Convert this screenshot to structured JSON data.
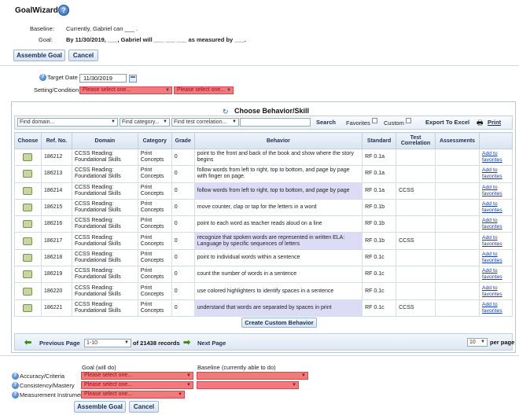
{
  "header": {
    "title": "GoalWizard",
    "help_glyph": "?",
    "baseline_label": "Baseline:",
    "baseline_text": "Currently, Gabriel can ___ .",
    "goal_label": "Goal:",
    "goal_text": "By 11/30/2019, ___, Gabriel will ___ ___ ___ as measured by ___.",
    "assemble_label": "Assemble Goal",
    "cancel_label": "Cancel"
  },
  "settings": {
    "target_date_label": "Target Date",
    "target_date_value": "11/30/2019",
    "setting_label": "Setting/Condition",
    "select_placeholder": "Please select one..."
  },
  "behavior": {
    "heading": "Choose Behavior/Skill",
    "find_domain": "Find domain...",
    "find_category": "Find category...",
    "find_test": "Find test correlation...",
    "search_label": "Search",
    "favorites_label": "Favorites",
    "custom_label": "Custom",
    "export_label": "Export To Excel",
    "print_label": "Print",
    "columns": [
      "Choose",
      "Ref. No.",
      "Domain",
      "Category",
      "Grade",
      "Behavior",
      "Standard",
      "Test Correlation",
      "Assessments",
      ""
    ],
    "rows": [
      {
        "ref": "186212",
        "domain": "CCSS Reading: Foundational Skills",
        "category": "Print Concepts",
        "grade": "0",
        "behavior": "point to the front and back of the book and show where the story begins",
        "standard": "RF 0.1a",
        "test": "",
        "fav": "Add to favorites",
        "hl": false
      },
      {
        "ref": "186213",
        "domain": "CCSS Reading: Foundational Skills",
        "category": "Print Concepts",
        "grade": "0",
        "behavior": "follow words from left to right, top to bottom, and page by page with finger on page.",
        "standard": "RF 0.1a",
        "test": "",
        "fav": "Add to favorites",
        "hl": false
      },
      {
        "ref": "186214",
        "domain": "CCSS Reading: Foundational Skills",
        "category": "Print Concepts",
        "grade": "0",
        "behavior": "follow words from left to right, top to bottom, and page by page",
        "standard": "RF 0.1a",
        "test": "CCSS",
        "fav": "Add to favorites",
        "hl": true
      },
      {
        "ref": "186215",
        "domain": "CCSS Reading: Foundational Skills",
        "category": "Print Concepts",
        "grade": "0",
        "behavior": "move counter, clap or tap for the letters in a word",
        "standard": "RF 0.1b",
        "test": "",
        "fav": "Add to favorites",
        "hl": false
      },
      {
        "ref": "186216",
        "domain": "CCSS Reading: Foundational Skills",
        "category": "Print Concepts",
        "grade": "0",
        "behavior": "point to each word as teacher reads aloud on a line",
        "standard": "RF 0.1b",
        "test": "",
        "fav": "Add to favorites",
        "hl": false
      },
      {
        "ref": "186217",
        "domain": "CCSS Reading: Foundational Skills",
        "category": "Print Concepts",
        "grade": "0",
        "behavior": "recognize that spoken words are represented in written ELA: Language by specific sequences of letters",
        "standard": "RF 0.1b",
        "test": "CCSS",
        "fav": "Add to favorites",
        "hl": true
      },
      {
        "ref": "186218",
        "domain": "CCSS Reading: Foundational Skills",
        "category": "Print Concepts",
        "grade": "0",
        "behavior": "point to individual words within a sentence",
        "standard": "RF 0.1c",
        "test": "",
        "fav": "Add to favorites",
        "hl": false
      },
      {
        "ref": "186219",
        "domain": "CCSS Reading: Foundational Skills",
        "category": "Print Concepts",
        "grade": "0",
        "behavior": "count the number of words in a sentence",
        "standard": "RF 0.1c",
        "test": "",
        "fav": "Add to favorites",
        "hl": false
      },
      {
        "ref": "186220",
        "domain": "CCSS Reading: Foundational Skills",
        "category": "Print Concepts",
        "grade": "0",
        "behavior": "use colored highlighters to identify spaces in a sentence",
        "standard": "RF 0.1c",
        "test": "",
        "fav": "Add to favorites",
        "hl": false
      },
      {
        "ref": "186221",
        "domain": "CCSS Reading: Foundational Skills",
        "category": "Print Concepts",
        "grade": "0",
        "behavior": "understand that words are separated by spaces in print",
        "standard": "RF 0.1c",
        "test": "CCSS",
        "fav": "Add to favorites",
        "hl": true
      }
    ],
    "custom_behavior_label": "Create Custom Behavior"
  },
  "pager": {
    "prev_label": "Previous Page",
    "range_value": "1-10",
    "records_text": "of 21438 records",
    "next_label": "Next Page",
    "per_page_value": "10",
    "per_page_label": "per page"
  },
  "bottom": {
    "goal_header": "Goal (will do)",
    "baseline_header": "Baseline (currently able to do)",
    "accuracy_label": "Accuracy/Criteria",
    "consistency_label": "Consistency/Mastery",
    "measurement_label": "Measurement Instrument",
    "select_placeholder": "Please select one...",
    "assemble_label": "Assemble Goal",
    "cancel_label": "Cancel"
  },
  "colors": {
    "accent": "#2a63b4",
    "required_select": "#f2797c",
    "highlight_row": "#dcdcf7"
  }
}
